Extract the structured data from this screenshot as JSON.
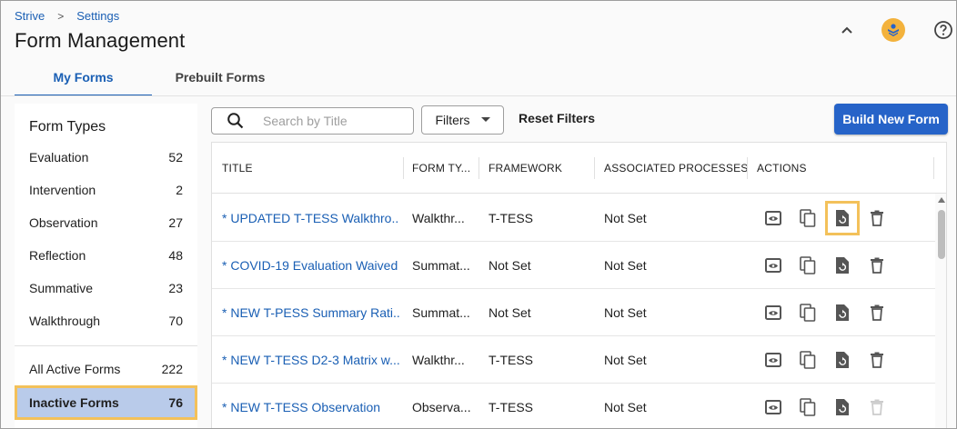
{
  "breadcrumb": {
    "home": "Strive",
    "separator": ">",
    "current": "Settings"
  },
  "page": {
    "title": "Form Management"
  },
  "tabs": [
    {
      "label": "My Forms",
      "active": true
    },
    {
      "label": "Prebuilt Forms",
      "active": false
    }
  ],
  "sidebar": {
    "title": "Form Types",
    "items": [
      {
        "label": "Evaluation",
        "count": "52"
      },
      {
        "label": "Intervention",
        "count": "2"
      },
      {
        "label": "Observation",
        "count": "27"
      },
      {
        "label": "Reflection",
        "count": "48"
      },
      {
        "label": "Summative",
        "count": "23"
      },
      {
        "label": "Walkthrough",
        "count": "70"
      }
    ],
    "all_active": {
      "label": "All Active Forms",
      "count": "222"
    },
    "inactive": {
      "label": "Inactive Forms",
      "count": "76"
    }
  },
  "toolbar": {
    "search_placeholder": "Search by Title",
    "filters_label": "Filters",
    "reset_label": "Reset Filters",
    "build_label": "Build New Form"
  },
  "table": {
    "columns": [
      "TITLE",
      "FORM TY...",
      "FRAMEWORK",
      "ASSOCIATED PROCESSES",
      "ACTIONS"
    ],
    "rows": [
      {
        "title": "* UPDATED T-TESS Walkthro...",
        "type": "Walkthr...",
        "framework": "T-TESS",
        "processes": "Not Set"
      },
      {
        "title": "* COVID-19 Evaluation Waived",
        "type": "Summat...",
        "framework": "Not Set",
        "processes": "Not Set"
      },
      {
        "title": "* NEW T-PESS Summary Rati...",
        "type": "Summat...",
        "framework": "Not Set",
        "processes": "Not Set"
      },
      {
        "title": "* NEW T-TESS D2-3 Matrix w...",
        "type": "Walkthr...",
        "framework": "T-TESS",
        "processes": "Not Set"
      },
      {
        "title": "* NEW T-TESS Observation",
        "type": "Observa...",
        "framework": "T-TESS",
        "processes": "Not Set"
      }
    ]
  },
  "colors": {
    "accent": "#1a5fb4",
    "primary_button": "#2663c8",
    "highlight": "#f3c15a",
    "selected_bg": "#b9cbea"
  },
  "icons": [
    "chevron-up-icon",
    "user-avatar-icon",
    "help-icon",
    "search-icon",
    "caret-down-icon",
    "preview-icon",
    "copy-icon",
    "restore-icon",
    "delete-icon"
  ]
}
